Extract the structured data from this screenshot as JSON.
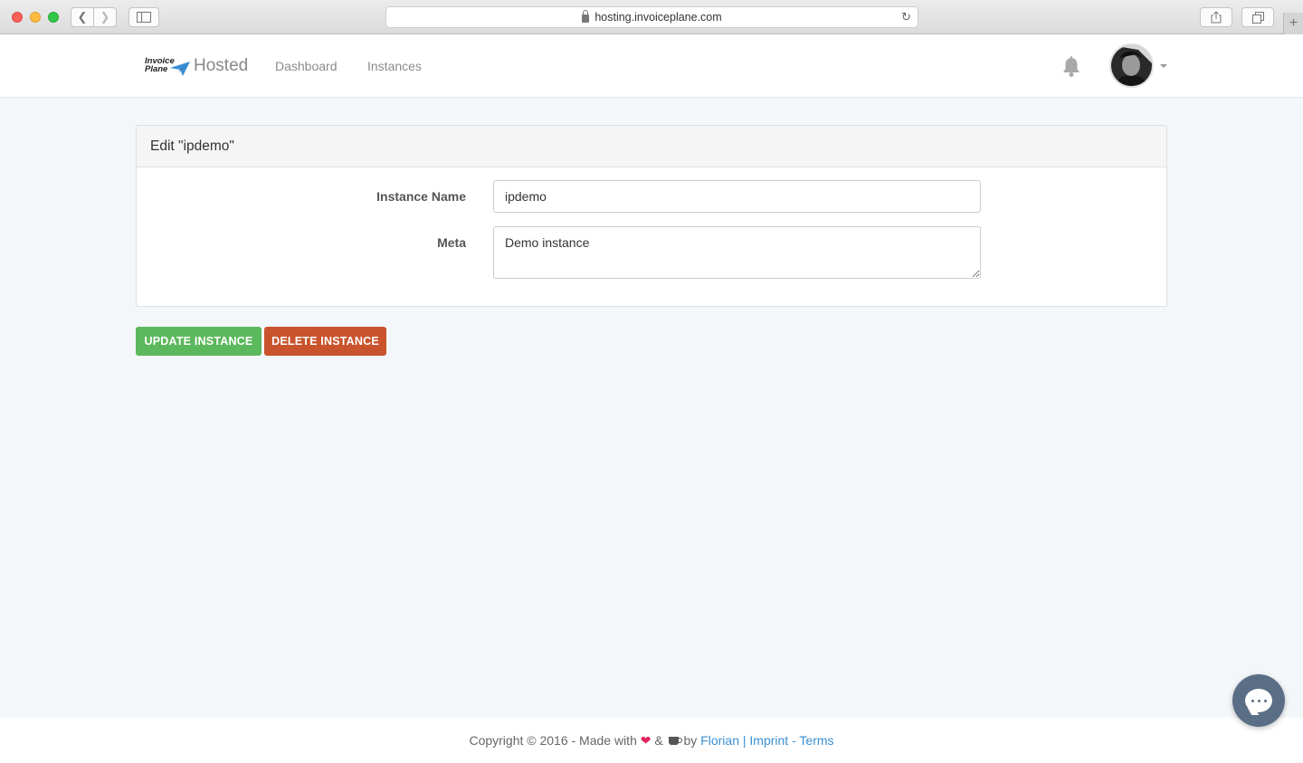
{
  "browser": {
    "url": "hosting.invoiceplane.com"
  },
  "navbar": {
    "logo_line1": "Invoice",
    "logo_line2": "Plane",
    "brand": "Hosted",
    "links": [
      "Dashboard",
      "Instances"
    ]
  },
  "panel": {
    "title": "Edit \"ipdemo\"",
    "fields": {
      "name_label": "Instance Name",
      "name_value": "ipdemo",
      "meta_label": "Meta",
      "meta_value": "Demo instance"
    }
  },
  "actions": {
    "update_label": "UPDATE INSTANCE",
    "delete_label": "DELETE INSTANCE"
  },
  "footer": {
    "prefix": "Copyright © 2016 - Made with",
    "amp": "&",
    "by": "by",
    "author": "Florian",
    "sep1": "|",
    "imprint": "Imprint",
    "sep2": "-",
    "terms": "Terms"
  },
  "colors": {
    "update_button": "#5cb85c",
    "delete_button": "#c9532c",
    "link": "#3a8fd3",
    "page_bg": "#f4f7fa"
  }
}
